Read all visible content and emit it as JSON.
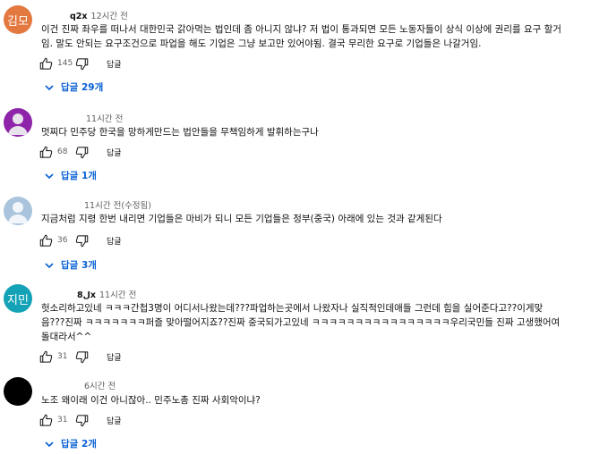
{
  "reply_label": "답글",
  "comments": [
    {
      "avatar_text": "김모",
      "avatar_color": "#e37840",
      "author": "q2x",
      "time": "12시간 전",
      "lines": [
        "이건 진짜 좌우를 떠나서 대한민국 갉아먹는 법인데 좀 아니지 않냐? 저 법이 통과되면 모든 노동자들이 상식 이상에 권리를 요구 할거",
        "임. 말도 안되는 요구조건으로 파업을 해도 기업은 그냥 보고만 있어야됨. 결국 무리한 요구로 기업들은 나갈거임."
      ],
      "likes": "145",
      "replies": "답글 29개"
    },
    {
      "avatar_text": "",
      "avatar_color": "#8e24aa",
      "author": "",
      "time": "11시간 전",
      "lines": [
        "멋찌다 민주당 한국을 망하게만드는 법안들을 무책임하게 발휘하는구나"
      ],
      "likes": "68",
      "replies": "답글 1개"
    },
    {
      "avatar_text": "",
      "avatar_color": "#a9c4dc",
      "author": "",
      "time": "11시간 전(수정됨)",
      "lines": [
        "지금처럼 지령 한번 내리면 기업들은 마비가 되니 모든 기업들은 정부(중국) 아래에 있는 것과 같게된다"
      ],
      "likes": "36",
      "replies": "답글 3개"
    },
    {
      "avatar_text": "지민",
      "avatar_color": "#14a3b6",
      "author": "ل8x",
      "time": "11시간 전",
      "lines": [
        "헛소리하고있네 ㅋㅋㅋ간첩3명이 어디서나왔는데???파업하는곳에서 나왔자나 실직적인데애들 그런데 힘을 실어준다고??이게맞",
        "음???진짜 ㅋㅋㅋㅋㅋㅋㅋ퍼즐 맞아떨어지죠??진짜 중국되가고있네 ㅋㅋㅋㅋㅋㅋㅋㅋㅋㅋㅋㅋㅋㅋㅋㅋ우리국민들 진짜 고생했어여",
        "돌대라서^^"
      ],
      "likes": "31",
      "replies": ""
    },
    {
      "avatar_text": "",
      "avatar_color": "#000000",
      "author": "",
      "time": "6시간 전",
      "lines": [
        "노조 왜이래 이건 아니잖아.. 민주노총 진짜 사회악이냐?"
      ],
      "likes": "31",
      "replies": "답글 2개"
    }
  ]
}
